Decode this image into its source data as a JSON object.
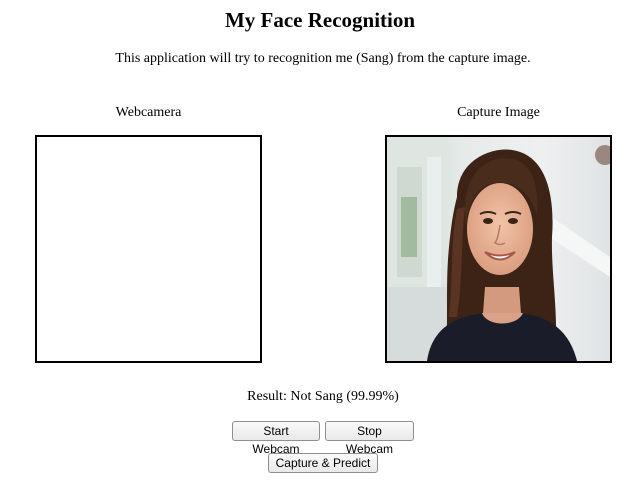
{
  "page": {
    "title": "My Face Recognition",
    "description": "This application will try to recognition me (Sang) from the capture image."
  },
  "webcam": {
    "label": "Webcamera"
  },
  "capture": {
    "label": "Capture Image",
    "image_subject": "smiling woman with long brown hair in dark top"
  },
  "result": {
    "text": "Result: Not Sang (99.99%)"
  },
  "buttons": {
    "start_webcam": "Start Webcam",
    "stop_webcam": "Stop Webcam",
    "capture_predict": "Capture & Predict"
  }
}
